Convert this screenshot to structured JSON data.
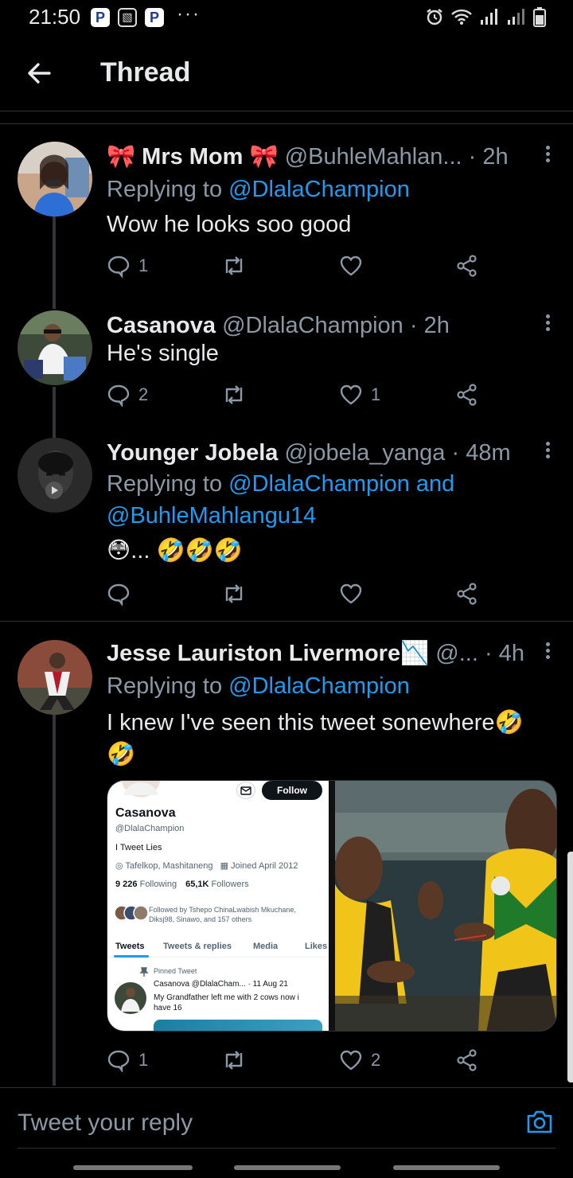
{
  "status_bar": {
    "time": "21:50",
    "app_icon_1": "P",
    "app_icon_3": "P",
    "more": "···"
  },
  "header": {
    "title": "Thread",
    "back_icon": "arrow-left-icon"
  },
  "tweets": [
    {
      "name": "🎀 Mrs Mom 🎀",
      "handle": "@BuhleMahlan...",
      "dot": "·",
      "age": "2h",
      "reply_prefix": "Replying to",
      "reply_to": "@DlalaChampion",
      "text": "Wow he looks soo good",
      "reply_count": "1",
      "retweet_count": "",
      "like_count": ""
    },
    {
      "name": "Casanova",
      "handle": "@DlalaChampion",
      "dot": "·",
      "age": "2h",
      "text": "He's single",
      "reply_count": "2",
      "retweet_count": "",
      "like_count": "1"
    },
    {
      "name": "Younger Jobela",
      "handle": "@jobela_yanga",
      "dot": "·",
      "age": "48m",
      "reply_prefix": "Replying to",
      "reply_to": "@DlalaChampion and",
      "reply_to_2": "@BuhleMahlangu14",
      "text": "😳... 🤣🤣🤣",
      "reply_count": "",
      "retweet_count": "",
      "like_count": ""
    },
    {
      "name": "Jesse Lauriston Livermore📉",
      "handle": "@...",
      "dot": "·",
      "age": "4h",
      "reply_prefix": "Replying to",
      "reply_to": "@DlalaChampion",
      "text_line_1": "I knew I've seen this tweet sonewhere🤣",
      "text_line_2": "🤣",
      "reply_count": "1",
      "retweet_count": "",
      "like_count": "2",
      "media": {
        "profile_name": "Casanova",
        "profile_handle": "@DlalaChampion",
        "follow_label": "Follow",
        "bio": "I Tweet Lies",
        "location": "Tafelkop, Mashitaneng",
        "joined": "Joined April 2012",
        "following_count": "9 226",
        "following_label": "Following",
        "followers_count": "65,1K",
        "followers_label": "Followers",
        "followed_by": "Followed by Tshepo ChinaLwabish Mkuchane, Diksj98, Sinawo, and 157 others",
        "tabs": [
          "Tweets",
          "Tweets & replies",
          "Media",
          "Likes"
        ],
        "pinned_label": "Pinned Tweet",
        "pinned_head": "Casanova @DlalaCham... · 11 Aug 21",
        "pinned_text": "My Grandfather left me with 2 cows now i have 16"
      }
    }
  ],
  "composer": {
    "placeholder": "Tweet your reply",
    "camera_icon": "camera-icon"
  },
  "colors": {
    "background": "#000000",
    "link": "#1d9bf0",
    "muted": "#8b98a5",
    "divider": "#2f3336"
  }
}
